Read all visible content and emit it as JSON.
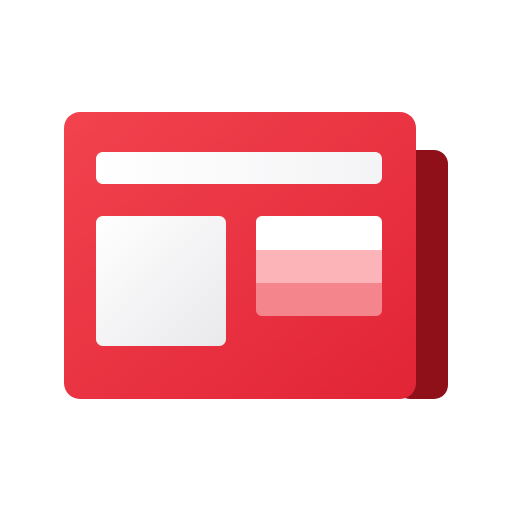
{
  "icon": {
    "name": "news-icon",
    "colors": {
      "page_red_light": "#F0434F",
      "page_red_dark": "#E02434",
      "back_page": "#8F1019",
      "back_page_shadow": "#B0151F",
      "white_light": "#FFFFFF",
      "white_shade": "#ECECEE",
      "pink_light": "#FCB7BB",
      "pink_dark": "#F6858C"
    }
  }
}
